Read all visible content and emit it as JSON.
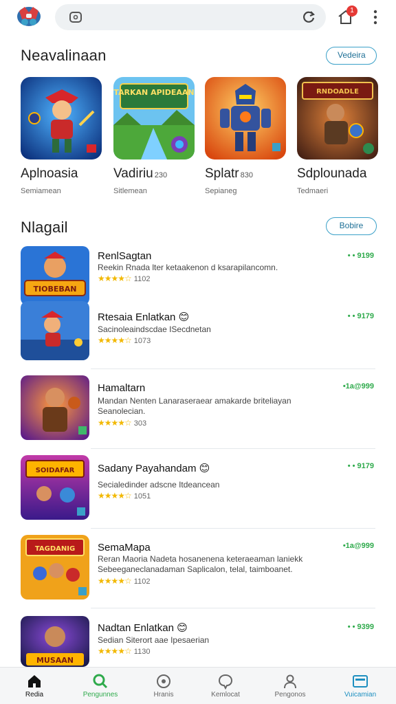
{
  "topbar": {
    "notif_count": "1"
  },
  "section1": {
    "title": "Neavalinaan",
    "button": "Vedeira"
  },
  "featured": [
    {
      "name": "Aplnoasia",
      "suffix": "",
      "sub": "Semiamean",
      "art": "hero-red"
    },
    {
      "name": "Vadiriu",
      "suffix": "230",
      "sub": "Sitlemean",
      "art": "landscape",
      "banner": "TARKAN APIDEAAN"
    },
    {
      "name": "Splatr",
      "suffix": "830",
      "sub": "Sepianeg",
      "art": "robot"
    },
    {
      "name": "Sdplounada",
      "suffix": "",
      "sub": "Tedmaeri",
      "art": "warrior",
      "banner": "RNDOADLE"
    }
  ],
  "section2": {
    "title": "Nlagail",
    "button": "Bobire"
  },
  "list": [
    {
      "title": "RenlSagtan",
      "desc": "Reekin Rnada lter ketaakenon d ksarapilancomn.",
      "rating": "1102",
      "stars": "★★★★☆",
      "price": "• • 9199",
      "banner": "TIOBEBAN",
      "emoji": ""
    },
    {
      "title": "Rtesaia Enlatkan",
      "desc": "Sacinoleaindscdae ISecdnetan",
      "rating": "1073",
      "stars": "★★★★☆",
      "price": "• • 9179",
      "banner": "",
      "emoji": "😊"
    },
    {
      "title": "Hamaltarn",
      "desc": "Mandan Nenten Lanaraseraear amakarde briteliayan Seanolecian.",
      "rating": "303",
      "stars": "★★★★☆",
      "price": "•1a@999",
      "banner": "",
      "emoji": ""
    },
    {
      "title": "Sadany Payahandam",
      "desc": "Secialedinder adscne Itdeancean",
      "rating": "1051",
      "stars": "★★★★☆",
      "price": "• • 9179",
      "banner": "SOIDAFAR",
      "emoji": "😊"
    },
    {
      "title": "SemaMapa",
      "desc": "Reran Maoria Nadeta hosanenena keteraeaman laniekk Sebeeganeclanadaman Saplicalon, telal, taimboanet.",
      "rating": "1102",
      "stars": "★★★★☆",
      "price": "•1a@999",
      "banner": "TAGDANIG",
      "emoji": ""
    },
    {
      "title": "Nadtan Enlatkan",
      "desc": "Sedian Siterort aae Ipesaerian",
      "rating": "1130",
      "stars": "★★★★☆",
      "price": "• • 9399",
      "banner": "MUSAAN",
      "emoji": "😊"
    }
  ],
  "bottom_nav": [
    {
      "label": "Redia",
      "icon": "home-icon"
    },
    {
      "label": "Pengunnes",
      "icon": "search-icon"
    },
    {
      "label": "Hranis",
      "icon": "compass-icon"
    },
    {
      "label": "Kemlocat",
      "icon": "chat-icon"
    },
    {
      "label": "Pengonos",
      "icon": "person-icon"
    },
    {
      "label": "Vuicamian",
      "icon": "library-icon"
    }
  ],
  "colors": {
    "accent": "#3aa0c8",
    "price_green": "#2eaa4b",
    "star": "#f2b800"
  }
}
